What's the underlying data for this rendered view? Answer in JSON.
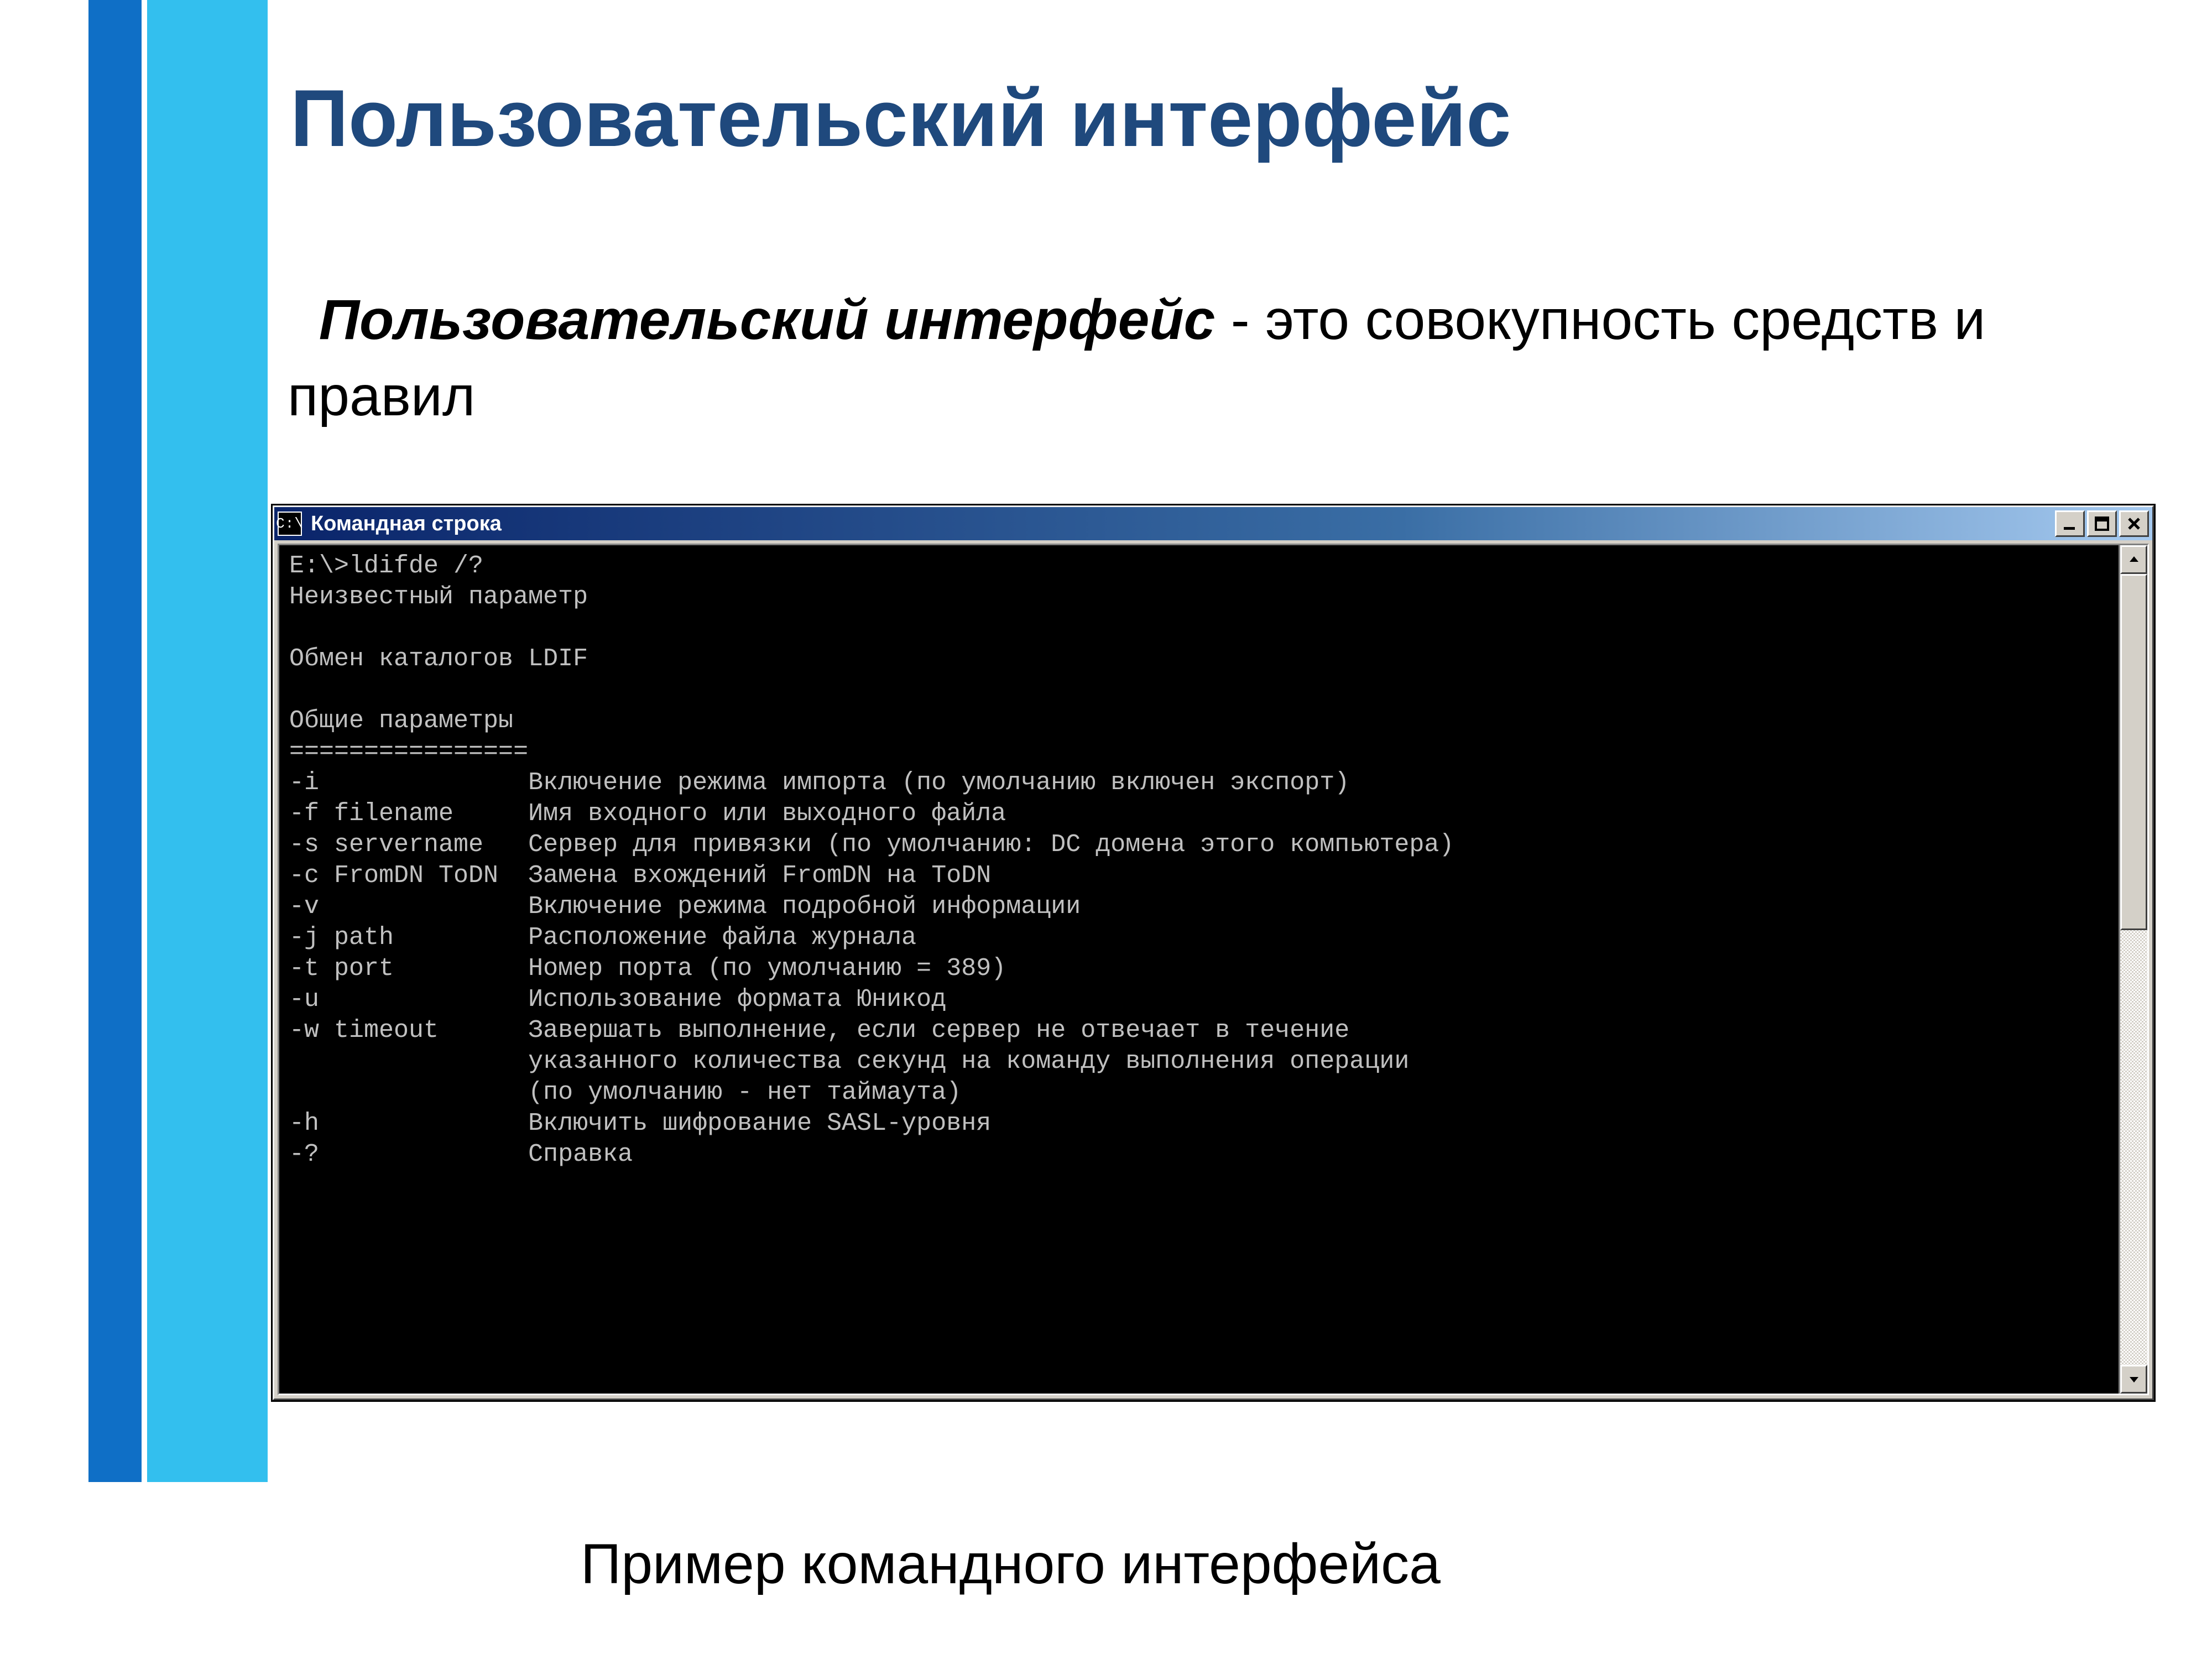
{
  "slide": {
    "title": "Пользовательский интерфейс",
    "body_lead": "Пользовательский интерфейс",
    "body_rest": " - это совокупность средств и правил",
    "caption": "Пример командного интерфейса"
  },
  "cmd": {
    "icon_label": "C:\\",
    "title": "Командная строка",
    "lines": [
      "E:\\>ldifde /?",
      "Неизвестный параметр",
      "",
      "Обмен каталогов LDIF",
      "",
      "Общие параметры",
      "================",
      "-i              Включение режима импорта (по умолчанию включен экспорт)",
      "-f filename     Имя входного или выходного файла",
      "-s servername   Сервер для привязки (по умолчанию: DC домена этого компьютера)",
      "-c FromDN ToDN  Замена вхождений FromDN на ToDN",
      "-v              Включение режима подробной информации",
      "-j path         Расположение файла журнала",
      "-t port         Номер порта (по умолчанию = 389)",
      "-u              Использование формата Юникод",
      "-w timeout      Завершать выполнение, если сервер не отвечает в течение",
      "                указанного количества секунд на команду выполнения операции",
      "                (по умолчанию - нет таймаута)",
      "-h              Включить шифрование SASL-уровня",
      "-?              Справка",
      ""
    ]
  }
}
